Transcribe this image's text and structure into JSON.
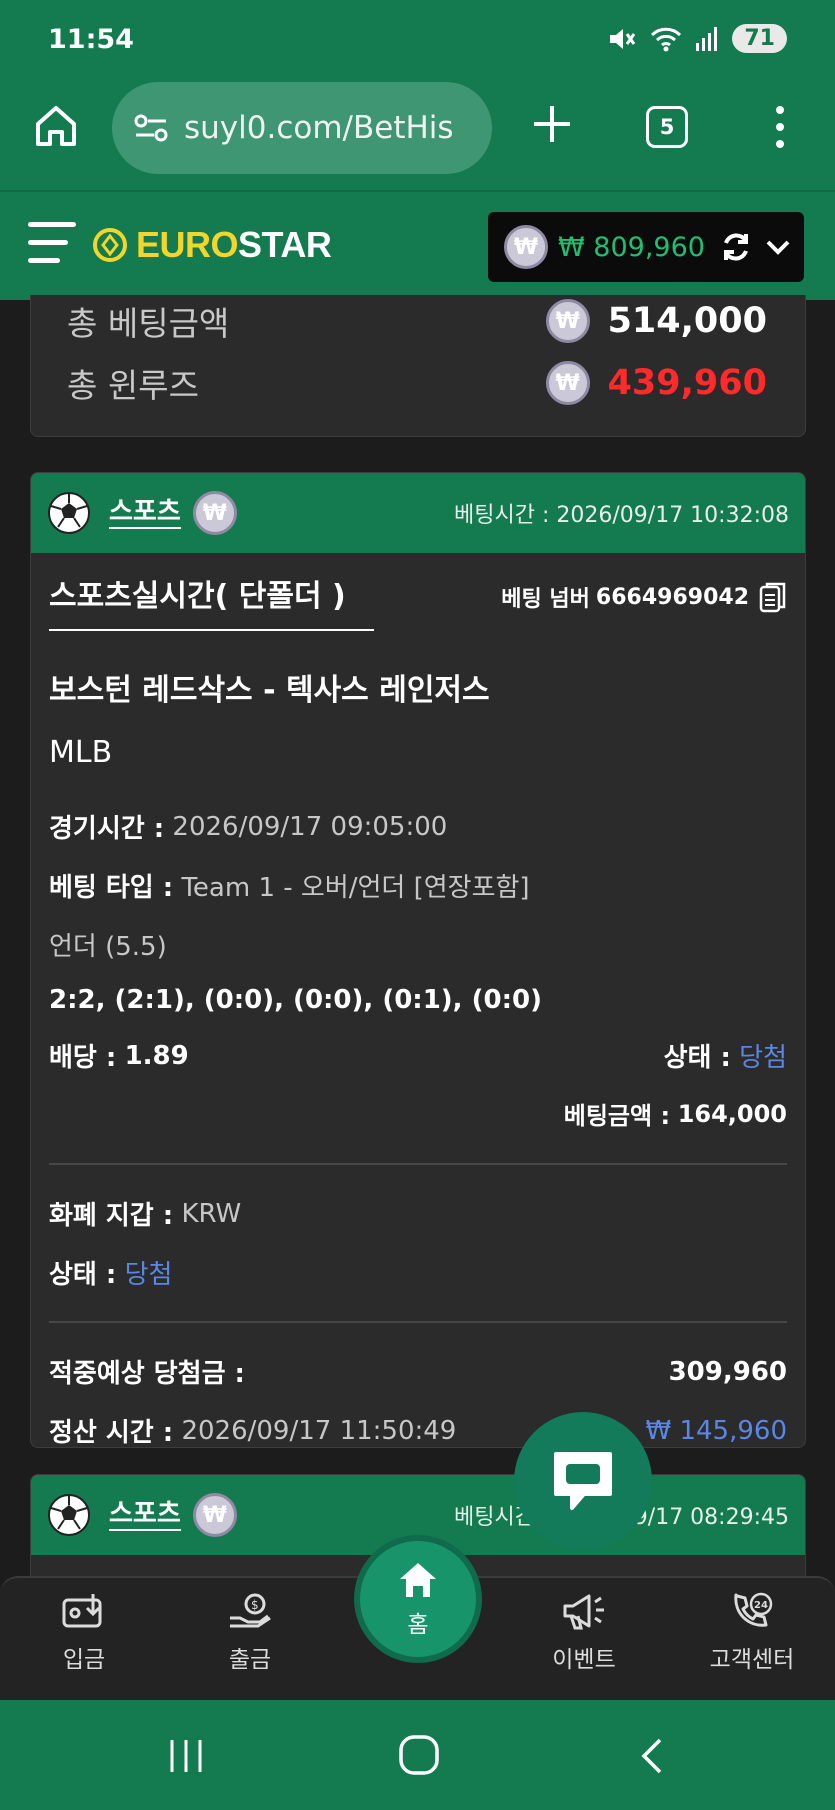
{
  "status_bar": {
    "time": "11:54",
    "battery": "71"
  },
  "browser": {
    "url": "suyl0.com/BetHis",
    "tab_count": "5"
  },
  "header": {
    "logo_part1": "EURO",
    "logo_part2": "STAR",
    "balance": "₩ 809,960"
  },
  "summary": {
    "total_bet_label": "총 베팅금액",
    "total_bet_value": "514,000",
    "total_winloss_label": "총 윈루즈",
    "total_winloss_value": "439,960"
  },
  "bet": {
    "category": "스포츠",
    "bet_time_label": "베팅시간 :",
    "bet_time": "2026/09/17 10:32:08",
    "type_title": "스포츠실시간( 단폴더 )",
    "bet_number_label": "베팅 넘버",
    "bet_number": "6664969042",
    "match": "보스턴 레드삭스 - 텍사스 레인저스",
    "league": "MLB",
    "game_time_label": "경기시간 :",
    "game_time": "2026/09/17 09:05:00",
    "bet_type_label": "베팅 타입 :",
    "bet_type": "Team 1 - 오버/언더 [연장포함]",
    "pick": "언더 (5.5)",
    "score": "2:2, (2:1), (0:0), (0:0), (0:1), (0:0)",
    "odds_label": "배당 :",
    "odds": "1.89",
    "status_label": "상태 :",
    "status": "당첨",
    "bet_amount_label": "베팅금액 :",
    "bet_amount": "164,000",
    "currency_label": "화폐 지갑 :",
    "currency": "KRW",
    "status2_label": "상태 :",
    "status2": "당첨",
    "expected_win_label": "적중예상 당첨금 :",
    "expected_win": "309,960",
    "settle_time_label": "정산 시간 :",
    "settle_time": "2026/09/17 11:50:49",
    "profit": "₩ 145,960"
  },
  "bet2": {
    "category": "스포츠",
    "bet_time_label": "베팅시간 :",
    "bet_time": "2026/09/17 08:29:45"
  },
  "nav": {
    "deposit": "입금",
    "withdraw": "출금",
    "home": "홈",
    "event": "이벤트",
    "support": "고객센터"
  },
  "colors": {
    "brand_green": "#147a4f",
    "loss_red": "#ff2a2a",
    "win_blue": "#5b86e5",
    "balance_green": "#1fbf73"
  }
}
